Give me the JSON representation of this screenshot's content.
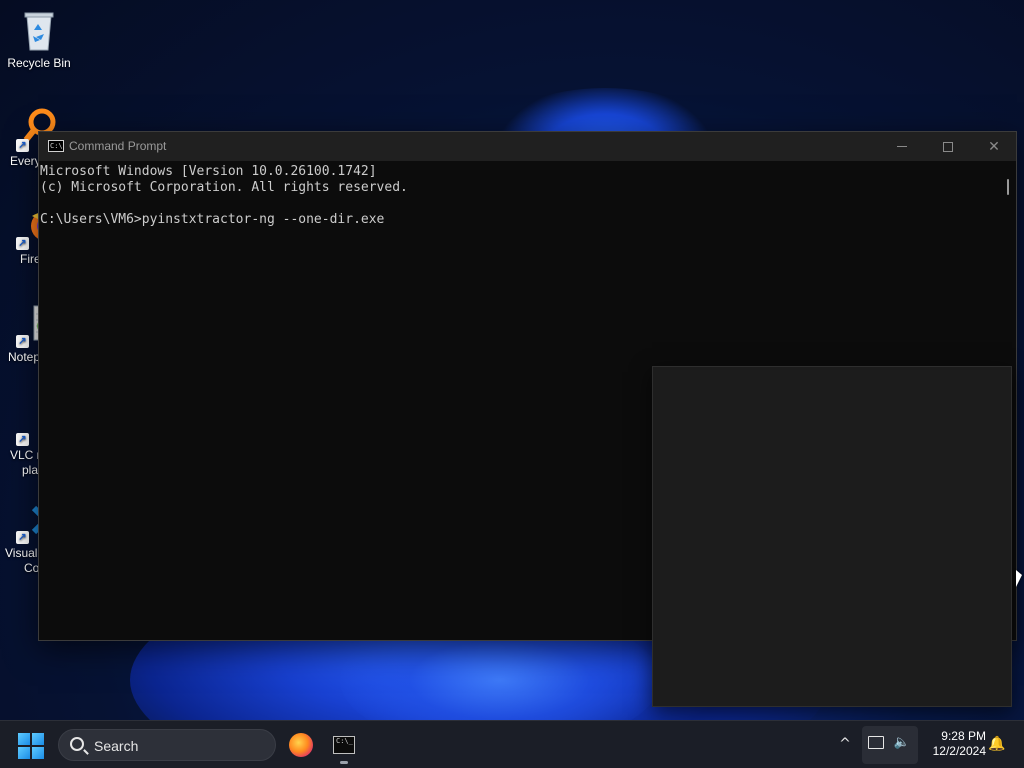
{
  "desktop": {
    "icons": [
      {
        "label": "Recycle Bin",
        "icon": "recycle-bin-icon"
      },
      {
        "label": "Every",
        "icon": "everything-search-icon"
      },
      {
        "label": "Fire",
        "icon": "firefox-icon"
      },
      {
        "label": "Notep",
        "icon": "notepad-plus-plus-icon"
      },
      {
        "label": "VLC r",
        "label2": "pla",
        "icon": "vlc-icon"
      },
      {
        "label": "Visual",
        "label2": "Co",
        "icon": "vscode-icon"
      }
    ]
  },
  "window": {
    "title": "Command Prompt",
    "console_lines": [
      "Microsoft Windows [Version 10.0.26100.1742]",
      "(c) Microsoft Corporation. All rights reserved.",
      "",
      "C:\\Users\\VM6>pyinstxtractor-ng --one-dir.exe"
    ]
  },
  "taskbar": {
    "search_placeholder": "Search",
    "apps": [
      "firefox-icon",
      "command-prompt-icon"
    ],
    "clock": {
      "time": "9:28 PM",
      "date": "12/2/2024"
    }
  },
  "colors": {
    "console_bg": "#0c0c0c",
    "console_text": "#cccccc",
    "taskbar_bg": "#1b1e27",
    "accent": "#1b8ce6"
  }
}
